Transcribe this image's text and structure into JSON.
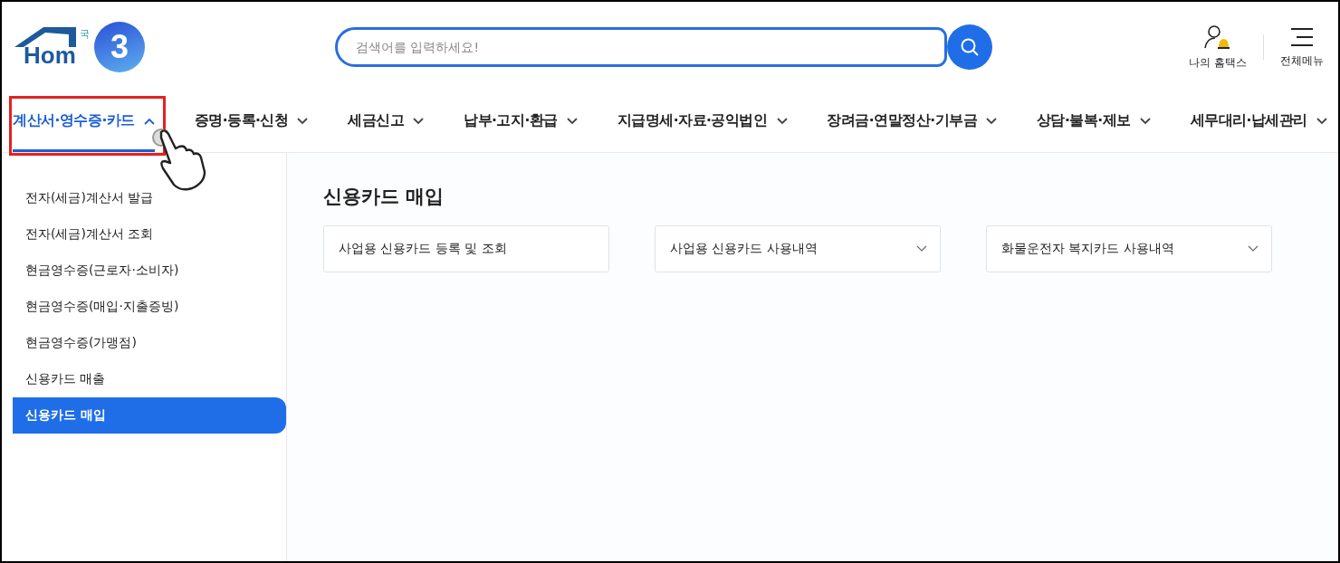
{
  "logo": {
    "word": "Hom",
    "caption": "국"
  },
  "step_badge": "3",
  "search": {
    "placeholder": "검색어를 입력하세요!"
  },
  "header_links": [
    {
      "label": "나의 홈택스",
      "kind": "user"
    },
    {
      "label": "전체메뉴",
      "kind": "menu"
    }
  ],
  "nav": [
    {
      "label": "계산서·영수증·카드",
      "selected": true
    },
    {
      "label": "증명·등록·신청",
      "selected": false
    },
    {
      "label": "세금신고",
      "selected": false
    },
    {
      "label": "납부·고지·환급",
      "selected": false
    },
    {
      "label": "지급명세·자료·공익법인",
      "selected": false
    },
    {
      "label": "장려금·연말정산·기부금",
      "selected": false
    },
    {
      "label": "상담·불복·제보",
      "selected": false
    },
    {
      "label": "세무대리·납세관리",
      "selected": false
    }
  ],
  "sidebar": {
    "items": [
      {
        "label": "전자(세금)계산서 발급",
        "selected": false
      },
      {
        "label": "전자(세금)계산서 조회",
        "selected": false
      },
      {
        "label": "현금영수증(근로자·소비자)",
        "selected": false
      },
      {
        "label": "현금영수증(매입·지출증빙)",
        "selected": false
      },
      {
        "label": "현금영수증(가맹점)",
        "selected": false
      },
      {
        "label": "신용카드 매출",
        "selected": false
      },
      {
        "label": "신용카드 매입",
        "selected": true
      }
    ]
  },
  "content": {
    "title": "신용카드 매입",
    "cards": [
      {
        "label": "사업용 신용카드 등록 및 조회",
        "expandable": false
      },
      {
        "label": "사업용 신용카드 사용내역",
        "expandable": true
      },
      {
        "label": "화물운전자 복지카드 사용내역",
        "expandable": true
      }
    ]
  }
}
